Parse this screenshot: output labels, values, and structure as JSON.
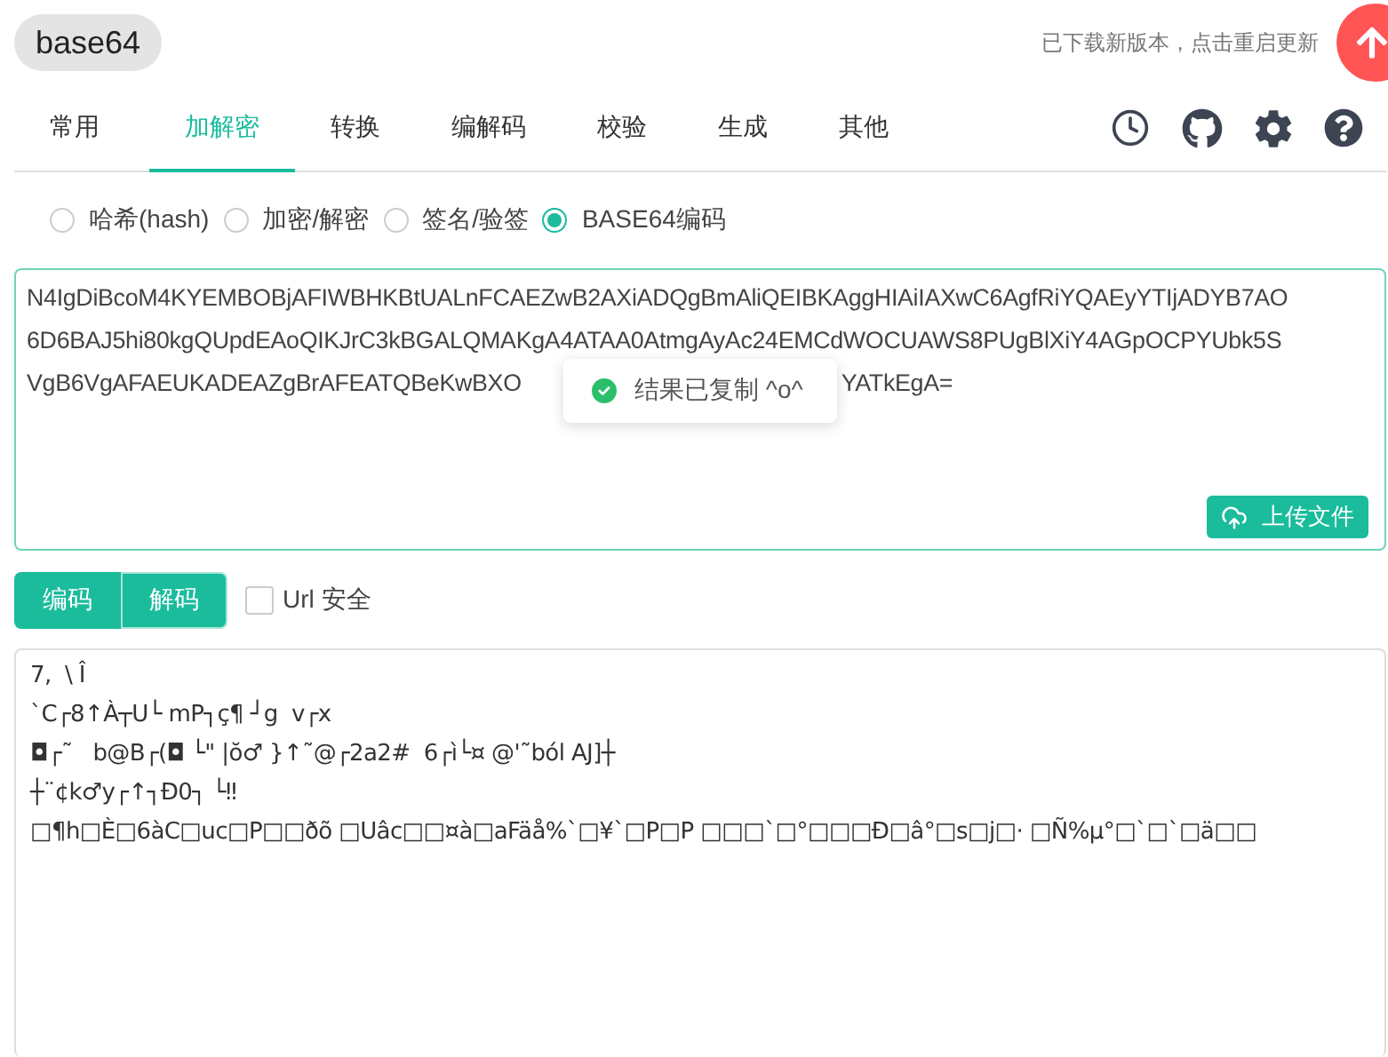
{
  "header": {
    "title": "base64",
    "update_notice": "已下载新版本，点击重启更新"
  },
  "tabs": [
    {
      "label": "常用",
      "selected": false
    },
    {
      "label": "加解密",
      "selected": true
    },
    {
      "label": "转换",
      "selected": false
    },
    {
      "label": "编解码",
      "selected": false
    },
    {
      "label": "校验",
      "selected": false
    },
    {
      "label": "生成",
      "selected": false
    },
    {
      "label": "其他",
      "selected": false
    }
  ],
  "modes": [
    {
      "label": "哈希(hash)",
      "selected": false
    },
    {
      "label": "加密/解密",
      "selected": false
    },
    {
      "label": "签名/验签",
      "selected": false
    },
    {
      "label": "BASE64编码",
      "selected": true
    }
  ],
  "input": {
    "lines": [
      "N4IgDiBcoM4KYEMBOBjAFIWBHKBtUALnFCAEZwB2AXiADQgBmAliQEIBKAggHIAiIAXwC6AgfRiYQAEyYTIjADYB7AO",
      "6D6BAJ5hi80kgQUpdEAoQIKJrC3kBGALQMAKgA4ATAA0AtmgAyAc24EMCdWOCUAWS8PUgBlXiY4AGpOCPYUbk5S"
    ],
    "last_line_start": "VgB6VgAFAEUKADEAZgBrAFEATQBeKwBXO",
    "last_line_end": "YATkEgA=",
    "upload_button": "上传文件"
  },
  "toast": {
    "message": "结果已复制 ^o^"
  },
  "actions": [
    {
      "label": "编码",
      "selected": false
    },
    {
      "label": "解码",
      "selected": true
    }
  ],
  "url_safe": {
    "label": "Url 安全",
    "checked": false
  },
  "output": {
    "lines": [
      "7,  \\ Î",
      "`C┌8↑À┬U└ mP┐ç¶ ┘g  v┌x",
      "◘┌˜   b@B┌(◘ └\" |ŏ♂ }↑˜@┌2a2#  6┌ì└¤ @'˜ból AJ]┼",
      "┼¨¢k♂y┌↑┐Ð0┐ └‼",
      "□¶h□È□6àC□uc□P□□ðõ □Uâc□□¤à□aFäå%`□¥`□P□P □□□`□°□□□Ð□â°□s□j□· □Ñ%µ°□`□`□ä□□"
    ]
  }
}
